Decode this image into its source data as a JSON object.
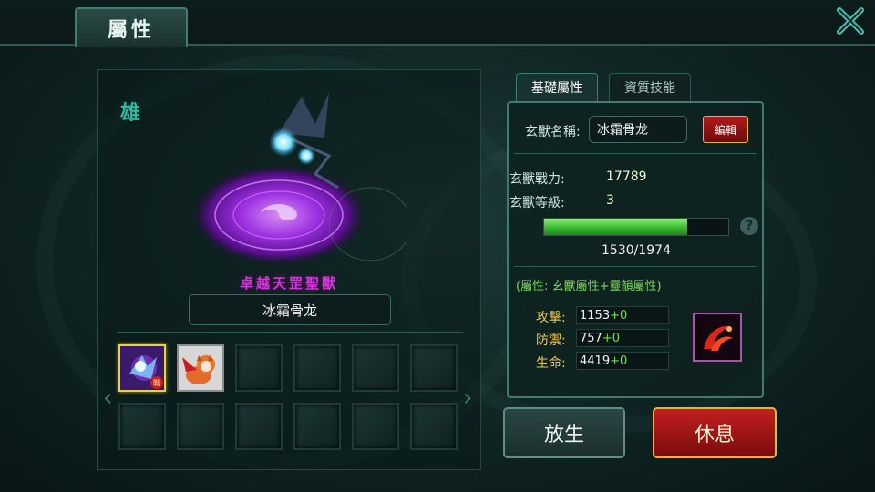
{
  "header": {
    "title": "屬性"
  },
  "beast": {
    "gender": "雄",
    "rank": "卓越天罡聖獸",
    "name": "冰霜骨龙"
  },
  "tabs": [
    {
      "label": "基礎屬性",
      "active": true
    },
    {
      "label": "資質技能",
      "active": false
    }
  ],
  "stats": {
    "name_label": "玄獸名稱:",
    "name_value": "冰霜骨龙",
    "edit_label": "編輯",
    "power_label": "玄獸戰力:",
    "power_value": "17789",
    "level_label": "玄獸等級:",
    "level_value": "3",
    "exp_text": "1530/1974",
    "exp_current": 1530,
    "exp_max": 1974,
    "attr_note": "(屬性: 玄獸屬性+靈韻屬性)",
    "rows": [
      {
        "label": "攻擊:",
        "base": "1153",
        "bonus": "+0"
      },
      {
        "label": "防禦:",
        "base": "757",
        "bonus": "+0"
      },
      {
        "label": "生命:",
        "base": "4419",
        "bonus": "+0"
      }
    ]
  },
  "slots": {
    "selected_badge": "戰",
    "items": [
      "frost-bone-dragon",
      "fox-beast",
      "empty",
      "empty",
      "empty",
      "empty",
      "empty",
      "empty",
      "empty",
      "empty",
      "empty",
      "empty"
    ]
  },
  "buttons": {
    "release": "放生",
    "rest": "休息"
  },
  "icons": {
    "close": "close-x-icon",
    "help": "?",
    "prev": "‹",
    "next": "›"
  },
  "colors": {
    "accent": "#3d7b73",
    "rest_button": "#c21f1f",
    "exp_fill": "#34b32a",
    "gold_label": "#f0c84a",
    "bonus_green": "#6fe04a",
    "rank_purple": "#cf3ad8"
  }
}
